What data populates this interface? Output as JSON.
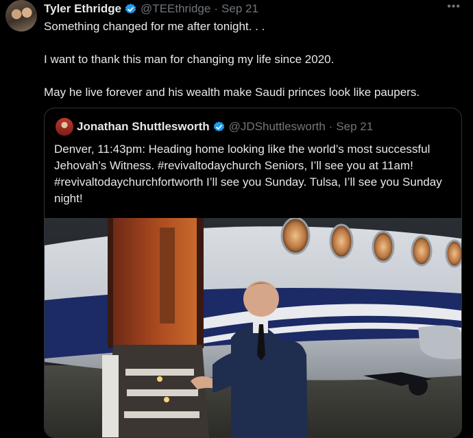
{
  "tweet": {
    "author_name": "Tyler Ethridge",
    "handle": "@TEEthridge",
    "separator": "·",
    "date": "Sep 21",
    "more_glyph": "•••",
    "paragraphs": [
      "Something changed for me after tonight. . .",
      "I want to thank this man for changing my life since 2020.",
      "May he live forever and his wealth make Saudi princes look like paupers."
    ]
  },
  "quoted_tweet": {
    "author_name": "Jonathan Shuttlesworth",
    "handle": "@JDShuttlesworth",
    "separator": "·",
    "date": "Sep 21",
    "text": "Denver, 11:43pm: Heading home looking like the world’s most successful Jehovah’s Witness. #revivaltodaychurch Seniors, I’ll see you at 11am! #revivaltodaychurchfortworth I’ll see you Sunday. Tulsa, I’ll see you Sunday night!"
  },
  "colors": {
    "background": "#000000",
    "text_primary": "#e7e9ea",
    "text_secondary": "#71767b",
    "verified": "#1d9bf0",
    "border": "#2f3336"
  },
  "icons": {
    "verified": "verified-badge-icon",
    "more": "more-options-icon"
  }
}
